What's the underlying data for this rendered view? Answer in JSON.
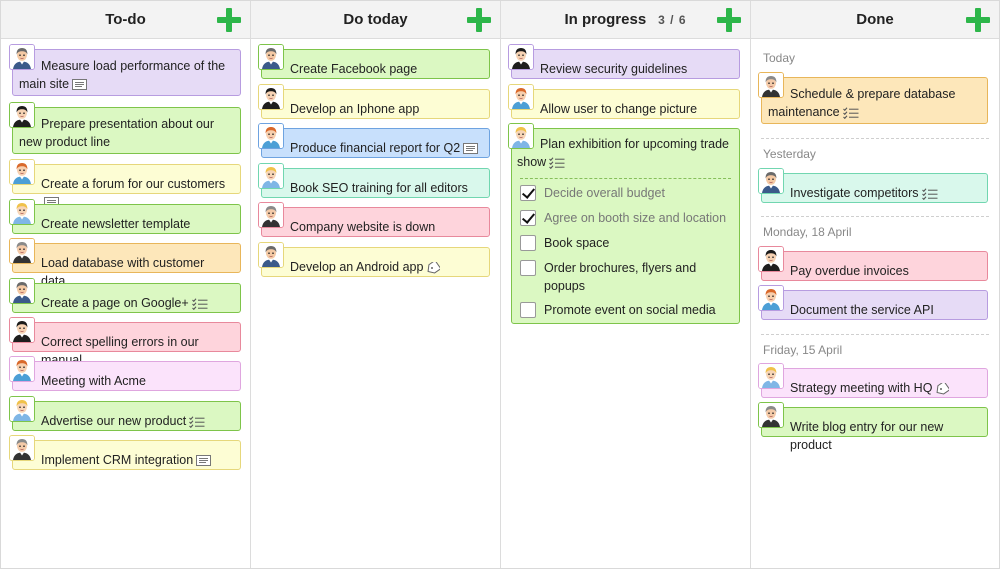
{
  "columns": [
    {
      "title": "To-do",
      "count": ""
    },
    {
      "title": "Do today",
      "count": ""
    },
    {
      "title": "In progress",
      "count": "3 / 6"
    },
    {
      "title": "Done",
      "count": ""
    }
  ],
  "todo": [
    {
      "text": "Measure load performance of the main site",
      "color": "purple",
      "icon": "note-icon"
    },
    {
      "text": "Prepare presentation about our new product line",
      "color": "green",
      "icon": ""
    },
    {
      "text": "Create a forum for our customers",
      "color": "yellow",
      "icon": "note-icon"
    },
    {
      "text": "Create newsletter template",
      "color": "green",
      "icon": ""
    },
    {
      "text": "Load database with customer data",
      "color": "orange",
      "icon": ""
    },
    {
      "text": "Create a page on Google+",
      "color": "green",
      "icon": "checklist-icon"
    },
    {
      "text": "Correct spelling errors in our manual",
      "color": "pink",
      "icon": ""
    },
    {
      "text": "Meeting with Acme",
      "color": "lilac",
      "icon": ""
    },
    {
      "text": "Advertise our new product",
      "color": "green",
      "icon": "checklist-icon"
    },
    {
      "text": "Implement CRM integration",
      "color": "yellow",
      "icon": "note-icon"
    }
  ],
  "today": [
    {
      "text": "Create Facebook page",
      "color": "green",
      "icon": ""
    },
    {
      "text": "Develop an Iphone app",
      "color": "yellow",
      "icon": ""
    },
    {
      "text": "Produce financial report for Q2",
      "color": "blue",
      "icon": "note-icon"
    },
    {
      "text": "Book SEO training for all editors",
      "color": "mint",
      "icon": ""
    },
    {
      "text": "Company website is down",
      "color": "pink",
      "icon": ""
    },
    {
      "text": "Develop an Android app",
      "color": "yellow",
      "icon": "tag-icon"
    }
  ],
  "progress": {
    "cards": [
      {
        "text": "Review security guidelines",
        "color": "purple",
        "icon": ""
      },
      {
        "text": "Allow user to change picture",
        "color": "yellow",
        "icon": ""
      }
    ],
    "expanded": {
      "text": "Plan exhibition for upcoming trade show",
      "color": "green",
      "icon": "checklist-icon",
      "checklist": [
        {
          "text": "Decide overall budget",
          "checked": true
        },
        {
          "text": "Agree on booth size and location",
          "checked": true
        },
        {
          "text": "Book space",
          "checked": false
        },
        {
          "text": "Order brochures, flyers and popups",
          "checked": false
        },
        {
          "text": "Promote event on social media",
          "checked": false
        }
      ]
    }
  },
  "done": {
    "sections": [
      {
        "label": "Today",
        "cards": [
          {
            "text": "Schedule & prepare database maintenance",
            "color": "orange",
            "icon": "checklist-icon"
          }
        ]
      },
      {
        "label": "Yesterday",
        "cards": [
          {
            "text": "Investigate competitors",
            "color": "mint",
            "icon": "checklist-icon"
          }
        ]
      },
      {
        "label": "Monday, 18 April",
        "cards": [
          {
            "text": "Pay overdue invoices",
            "color": "pink",
            "icon": ""
          },
          {
            "text": "Document the service API",
            "color": "purple",
            "icon": ""
          }
        ]
      },
      {
        "label": "Friday, 15 April",
        "cards": [
          {
            "text": "Strategy meeting with HQ",
            "color": "lilac",
            "icon": "tag-icon"
          },
          {
            "text": "Write blog entry for our new product",
            "color": "green",
            "icon": ""
          }
        ]
      }
    ]
  },
  "colors": {
    "add_button": "#2db64a",
    "header_bg": "#f3f3f3",
    "purple": "#e6dbf6",
    "green": "#dbf8c2",
    "yellow": "#fdfdd4",
    "orange": "#fde7ba",
    "pink": "#fed4dc",
    "lilac": "#fbe3fb",
    "blue": "#c8e0fc",
    "mint": "#d9f8ec"
  }
}
